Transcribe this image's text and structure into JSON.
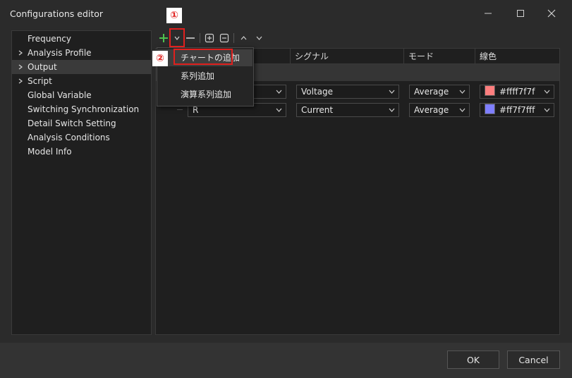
{
  "window": {
    "title": "Configurations editor"
  },
  "tree": {
    "items": [
      {
        "label": "Frequency",
        "expandable": false
      },
      {
        "label": "Analysis Profile",
        "expandable": true
      },
      {
        "label": "Output",
        "expandable": true,
        "selected": true
      },
      {
        "label": "Script",
        "expandable": true
      },
      {
        "label": "Global Variable",
        "expandable": false
      },
      {
        "label": "Switching Synchronization",
        "expandable": false
      },
      {
        "label": "Detail Switch Setting",
        "expandable": false
      },
      {
        "label": "Analysis Conditions",
        "expandable": false
      },
      {
        "label": "Model Info",
        "expandable": false
      }
    ]
  },
  "toolbar": {
    "add_color": "#4ec24e",
    "dropdown_icon": "chevron-down-icon",
    "remove_icon": "minus-icon",
    "expand_icon": "expand-all-icon",
    "collapse_icon": "collapse-all-icon",
    "move_up_icon": "chevron-up-icon",
    "move_down_icon": "chevron-down-icon"
  },
  "table": {
    "columns": [
      "シグナル",
      "モード",
      "線色"
    ],
    "rows": [
      {
        "element": "",
        "signal": "Voltage",
        "mode": "Average",
        "color_label": "#ffff7f7f",
        "swatch": "#ff7f7f"
      },
      {
        "element": "R",
        "signal": "Current",
        "mode": "Average",
        "color_label": "#ff7f7fff",
        "swatch": "#7f7fff"
      }
    ]
  },
  "menu": {
    "items": [
      {
        "label": "チャートの追加",
        "highlighted": true
      },
      {
        "label": "系列追加",
        "highlighted": false
      },
      {
        "label": "演算系列追加",
        "highlighted": false
      }
    ]
  },
  "annotations": {
    "badge1": "①",
    "badge2": "②",
    "accent": "#e0201e"
  },
  "footer": {
    "ok_label": "OK",
    "cancel_label": "Cancel"
  }
}
